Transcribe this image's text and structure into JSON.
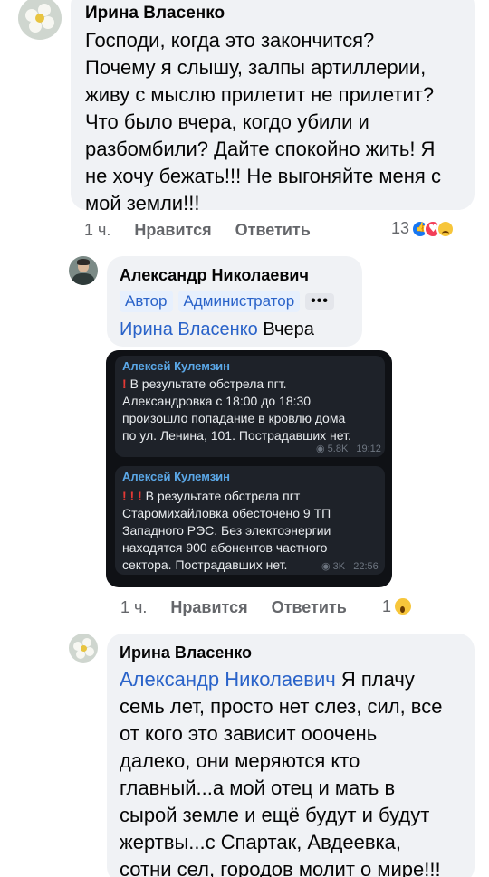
{
  "comment1": {
    "author": "Ирина Власенко",
    "lines": [
      "Господи, когда это закончится?",
      "Почему я слышу, залпы артиллерии,",
      "живу с мыслю прилетит не прилетит?",
      "Что было вчера, когдо убили и",
      "разбомбили? Дайте спокойно жить! Я",
      "не хочу бежать!!! Не выгоняйте меня с",
      "мой земли!!!"
    ],
    "time": "1 ч.",
    "like": "Нравится",
    "reply": "Ответить",
    "reactions_count": "13",
    "reactions": [
      "like-reaction-icon",
      "love-reaction-icon",
      "sad-reaction-icon"
    ]
  },
  "reply1": {
    "author": "Александр Николаевич",
    "badges": [
      "Автор",
      "Администратор",
      "•••"
    ],
    "mention": "Ирина Власенко",
    "text": "Вчера",
    "time": "1 ч.",
    "like": "Нравится",
    "reply": "Ответить",
    "reactions_count": "1",
    "reactions": [
      "wow-reaction-icon"
    ],
    "telegram": {
      "messages": [
        {
          "author": "Алексей Кулемзин",
          "lines": [
            "В результате обстрела пгт.",
            "Александровка с 18:00 до 18:30",
            "произошло попадание в кровлю дома",
            "по ул. Ленина, 101. Пострадавших нет."
          ],
          "views": "5.8K",
          "time": "19:12"
        },
        {
          "author": "Алексей Кулемзин",
          "lines": [
            "В результате обстрела пгт",
            "Старомихайловка обесточено 9 ТП",
            "Западного РЭС. Без электоэнергии",
            "находятся 900 абонентов частного",
            "сектора. Пострадавших нет."
          ],
          "views": "3K",
          "time": "22:56"
        }
      ]
    }
  },
  "reply2": {
    "author": "Ирина Власенко",
    "mention": "Александр Николаевич",
    "lines": [
      "Я плачу",
      "семь лет, просто нет слез, сил, все",
      "от кого это зависит ооочень",
      "далеко, они меряются кто",
      "главный...а мой отец и мать в",
      "сырой земле и ещё будут и будут",
      "жертвы...с Спартак, Авдеевка,",
      "сотни сел, городов молит о мире!!!"
    ]
  }
}
